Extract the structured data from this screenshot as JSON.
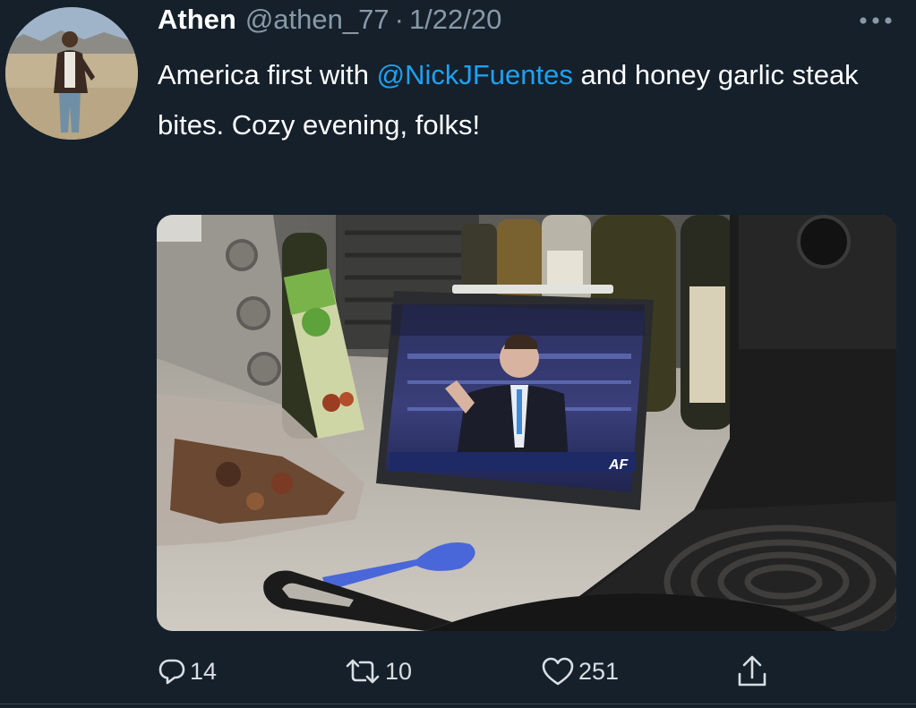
{
  "tweet": {
    "display_name": "Athen",
    "handle": "@athen_77",
    "separator": "·",
    "date": "1/22/20",
    "text_before": "America first with ",
    "mention": "@NickJFuentes",
    "text_after": " and honey garlic steak bites. Cozy evening, folks!"
  },
  "actions": {
    "reply_count": "14",
    "retweet_count": "10",
    "like_count": "251"
  },
  "media": {
    "screen_logo": "AF"
  },
  "colors": {
    "background": "#15202b",
    "secondary_text": "#8899a6",
    "link": "#1da1f2"
  },
  "icons": {
    "more": "more-horizontal-icon",
    "reply": "reply-bubble-icon",
    "retweet": "retweet-arrows-icon",
    "like": "heart-icon",
    "share": "share-upload-icon"
  }
}
